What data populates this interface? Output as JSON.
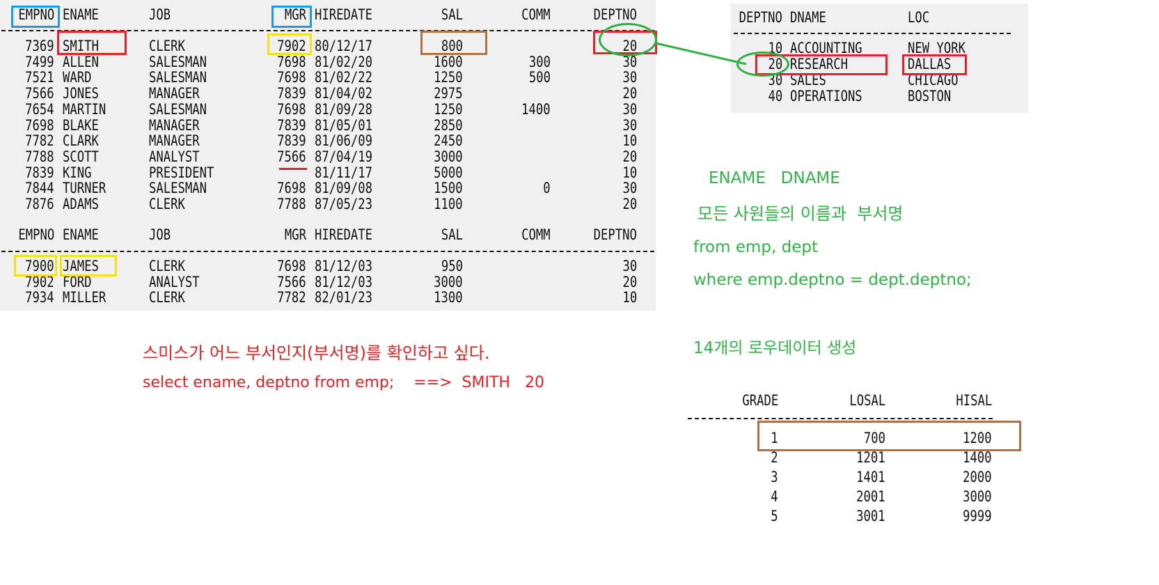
{
  "emp": {
    "headers": [
      "EMPNO",
      "ENAME",
      "JOB",
      "MGR",
      "HIREDATE",
      "SAL",
      "COMM",
      "DEPTNO"
    ],
    "rows": [
      [
        "7369",
        "SMITH",
        "CLERK",
        "7902",
        "80/12/17",
        "800",
        "",
        "20"
      ],
      [
        "7499",
        "ALLEN",
        "SALESMAN",
        "7698",
        "81/02/20",
        "1600",
        "300",
        "30"
      ],
      [
        "7521",
        "WARD",
        "SALESMAN",
        "7698",
        "81/02/22",
        "1250",
        "500",
        "30"
      ],
      [
        "7566",
        "JONES",
        "MANAGER",
        "7839",
        "81/04/02",
        "2975",
        "",
        "20"
      ],
      [
        "7654",
        "MARTIN",
        "SALESMAN",
        "7698",
        "81/09/28",
        "1250",
        "1400",
        "30"
      ],
      [
        "7698",
        "BLAKE",
        "MANAGER",
        "7839",
        "81/05/01",
        "2850",
        "",
        "30"
      ],
      [
        "7782",
        "CLARK",
        "MANAGER",
        "7839",
        "81/06/09",
        "2450",
        "",
        "10"
      ],
      [
        "7788",
        "SCOTT",
        "ANALYST",
        "7566",
        "87/04/19",
        "3000",
        "",
        "20"
      ],
      [
        "7839",
        "KING",
        "PRESIDENT",
        "",
        "81/11/17",
        "5000",
        "",
        "10"
      ],
      [
        "7844",
        "TURNER",
        "SALESMAN",
        "7698",
        "81/09/08",
        "1500",
        "0",
        "30"
      ],
      [
        "7876",
        "ADAMS",
        "CLERK",
        "7788",
        "87/05/23",
        "1100",
        "",
        "20"
      ],
      [
        "7900",
        "JAMES",
        "CLERK",
        "7698",
        "81/12/03",
        "950",
        "",
        "30"
      ],
      [
        "7902",
        "FORD",
        "ANALYST",
        "7566",
        "81/12/03",
        "3000",
        "",
        "20"
      ],
      [
        "7934",
        "MILLER",
        "CLERK",
        "7782",
        "82/01/23",
        "1300",
        "",
        "10"
      ]
    ]
  },
  "dept": {
    "headers": [
      "DEPTNO",
      "DNAME",
      "LOC"
    ],
    "rows": [
      [
        "10",
        "ACCOUNTING",
        "NEW YORK"
      ],
      [
        "20",
        "RESEARCH",
        "DALLAS"
      ],
      [
        "30",
        "SALES",
        "CHICAGO"
      ],
      [
        "40",
        "OPERATIONS",
        "BOSTON"
      ]
    ]
  },
  "salgrade": {
    "headers": [
      "GRADE",
      "LOSAL",
      "HISAL"
    ],
    "rows": [
      [
        "1",
        "700",
        "1200"
      ],
      [
        "2",
        "1201",
        "1400"
      ],
      [
        "3",
        "1401",
        "2000"
      ],
      [
        "4",
        "2001",
        "3000"
      ],
      [
        "5",
        "3001",
        "9999"
      ]
    ]
  },
  "notes": {
    "question": "스미스가 어느 부서인지(부서명)를 확인하고 싶다.",
    "query": "select ename, deptno from emp;    ==>  SMITH   20",
    "columns": "ENAME   DNAME",
    "description": "모든 사원들의 이름과  부서명",
    "from_clause": "from emp, dept",
    "where_clause": "where emp.deptno = dept.deptno;",
    "result": "14개의 로우데이터 생성"
  },
  "colors": {
    "blue": "#1e9be0",
    "red": "#e8202a",
    "yellow": "#f2e21a",
    "brown": "#a9724a",
    "green": "#2fb345"
  }
}
